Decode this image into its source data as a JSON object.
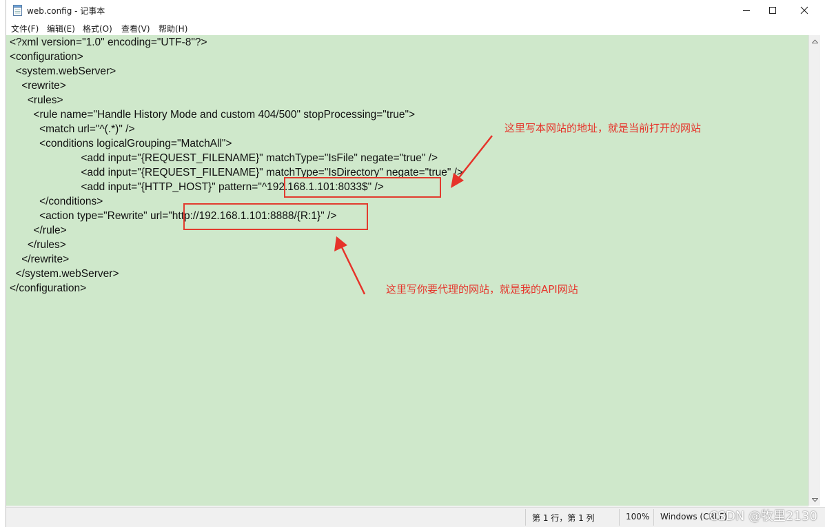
{
  "window": {
    "title": "web.config - 记事本",
    "controls": {
      "minimize": "minimize",
      "maximize": "maximize",
      "close": "close"
    }
  },
  "menu": [
    "文件(F)",
    "编辑(E)",
    "格式(O)",
    "查看(V)",
    "帮助(H)"
  ],
  "code_lines": [
    "<?xml version=\"1.0\" encoding=\"UTF-8\"?>",
    "<configuration>",
    "  <system.webServer>",
    "    <rewrite>",
    "      <rules>",
    "        <rule name=\"Handle History Mode and custom 404/500\" stopProcessing=\"true\">",
    "          <match url=\"^(.*)\" />",
    "          <conditions logicalGrouping=\"MatchAll\">",
    "                        <add input=\"{REQUEST_FILENAME}\" matchType=\"IsFile\" negate=\"true\" />",
    "                        <add input=\"{REQUEST_FILENAME}\" matchType=\"IsDirectory\" negate=\"true\" />",
    "                        <add input=\"{HTTP_HOST}\" pattern=\"^192.168.1.101:8033$\" />",
    "          </conditions>",
    "          <action type=\"Rewrite\" url=\"http://192.168.1.101:8888/{R:1}\" />",
    "        </rule>",
    "      </rules>",
    "    </rewrite>",
    "  </system.webServer>",
    "</configuration>"
  ],
  "annotations": {
    "host_note": "这里写本网站的地址，就是当前打开的网站",
    "proxy_note": "这里写你要代理的网站，就是我的API网站"
  },
  "status": {
    "position": "第 1 行，第 1 列",
    "zoom": "100%",
    "encoding": "Windows (CRLF)"
  },
  "watermark": "CSDN @牧里2130",
  "colors": {
    "editor_bg": "#cfe8cb",
    "annotation_red": "#e6332a"
  }
}
